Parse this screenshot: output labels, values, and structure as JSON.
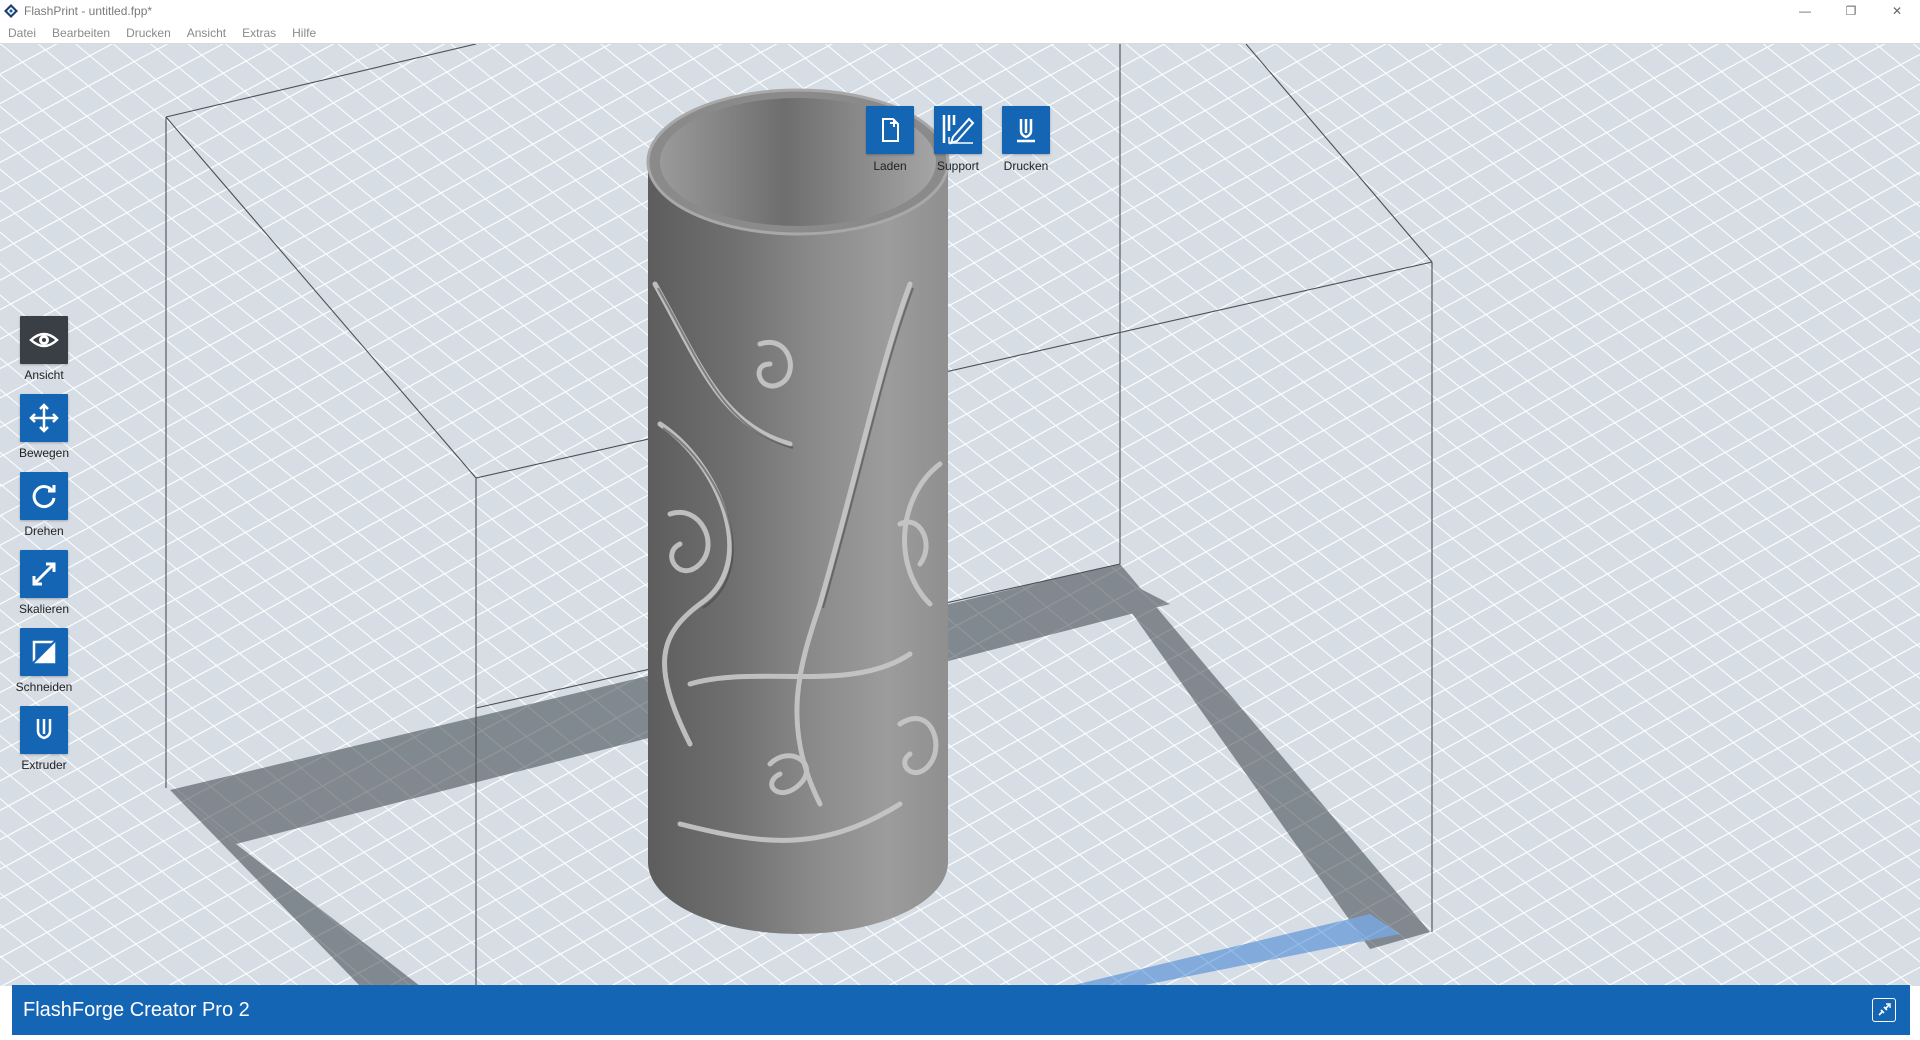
{
  "window": {
    "title": "FlashPrint - untitled.fpp*",
    "minimize": "—",
    "restore": "❐",
    "close": "✕"
  },
  "menu": {
    "items": [
      "Datei",
      "Bearbeiten",
      "Drucken",
      "Ansicht",
      "Extras",
      "Hilfe"
    ]
  },
  "top_toolbar": {
    "load_label": "Laden",
    "support_label": "Support",
    "print_label": "Drucken"
  },
  "left_toolbar": {
    "view_label": "Ansicht",
    "move_label": "Bewegen",
    "rotate_label": "Drehen",
    "scale_label": "Skalieren",
    "cut_label": "Schneiden",
    "extruder_label": "Extruder"
  },
  "status": {
    "printer_name": "FlashForge Creator Pro 2"
  },
  "icons": {
    "app": "flashprint-logo-icon",
    "load": "file-plus-icon",
    "support": "support-pencil-icon",
    "print": "extruder-nozzle-icon",
    "view": "eye-icon",
    "move": "move-arrows-icon",
    "rotate": "rotate-icon",
    "scale": "scale-diagonal-icon",
    "cut": "cut-plane-icon",
    "extruder": "extruder-icon",
    "connect": "connect-link-icon"
  },
  "colors": {
    "accent": "#1565b5",
    "active_tool": "#3a3f45",
    "grid_bg": "#e3e7ec",
    "model": "#7c7c7c"
  }
}
